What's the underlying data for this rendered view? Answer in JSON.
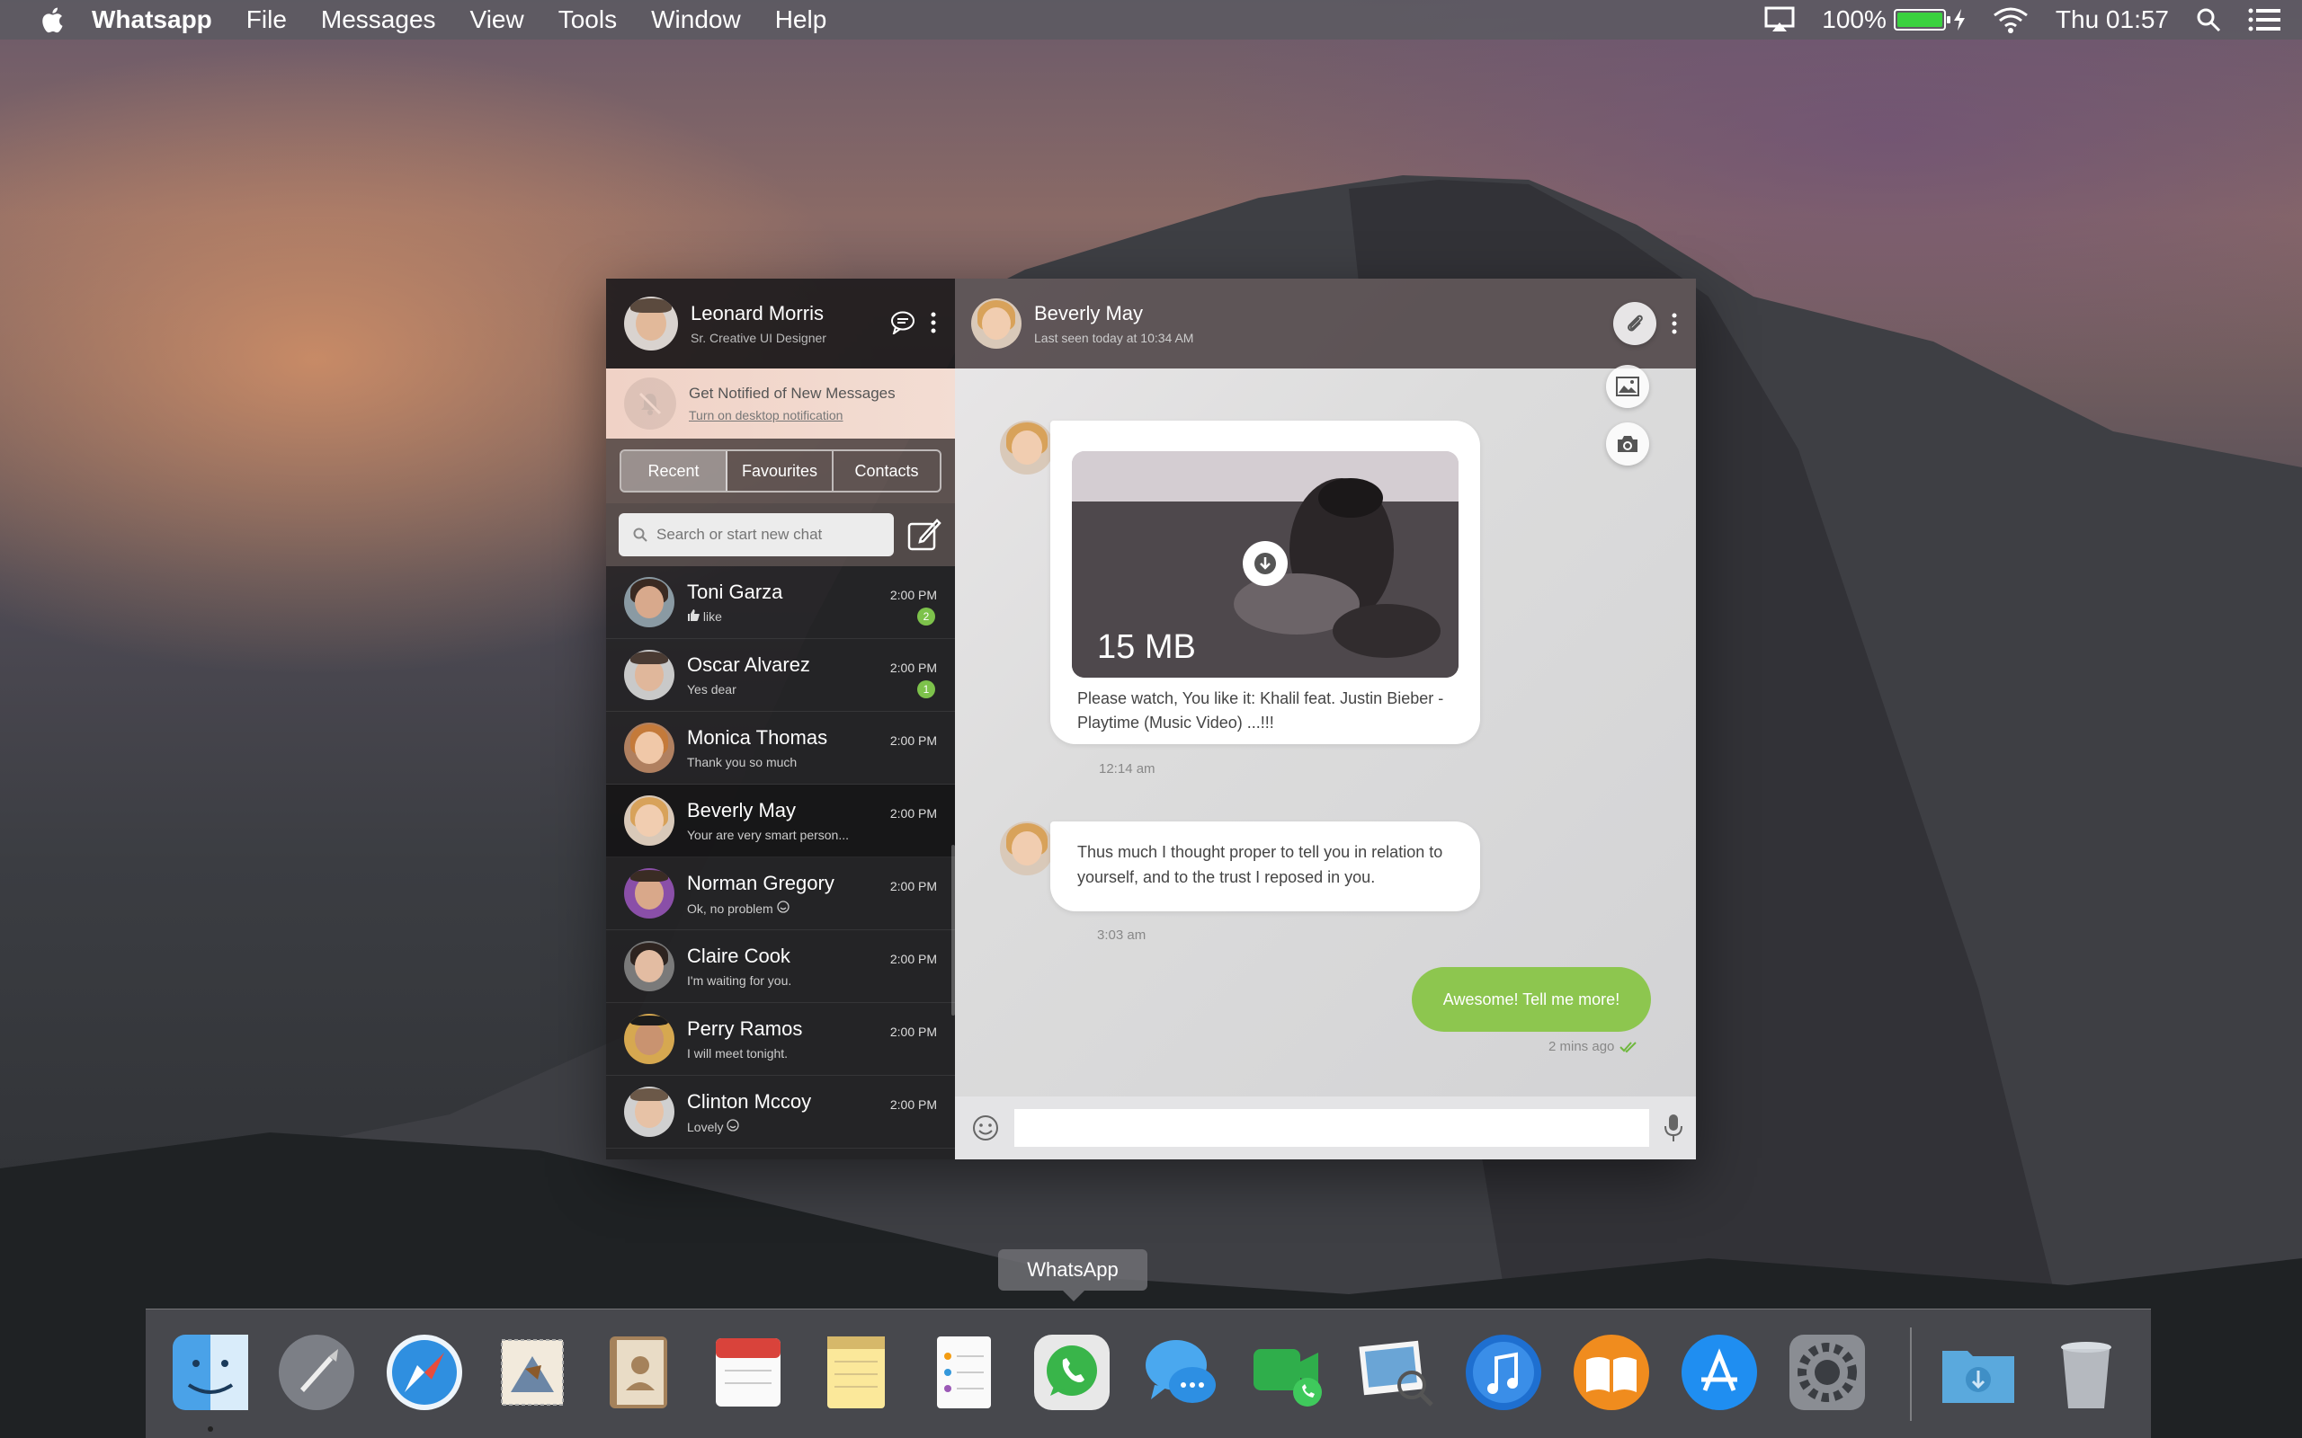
{
  "menubar": {
    "app_name": "Whatsapp",
    "menus": [
      "File",
      "Messages",
      "View",
      "Tools",
      "Window",
      "Help"
    ],
    "battery_percent": "100%",
    "clock": "Thu 01:57"
  },
  "sidebar": {
    "profile": {
      "name": "Leonard Morris",
      "title": "Sr. Creative UI Designer"
    },
    "notification": {
      "title": "Get Notified of New Messages",
      "link": "Turn on desktop notification"
    },
    "tabs": [
      "Recent",
      "Favourites",
      "Contacts"
    ],
    "active_tab": "Recent",
    "search_placeholder": "Search or start new chat",
    "chats": [
      {
        "name": "Toni Garza",
        "preview": "like",
        "time": "2:00 PM",
        "badge": "2"
      },
      {
        "name": "Oscar Alvarez",
        "preview": "Yes dear",
        "time": "2:00 PM",
        "badge": "1"
      },
      {
        "name": "Monica Thomas",
        "preview": "Thank you so much",
        "time": "2:00 PM"
      },
      {
        "name": "Beverly May",
        "preview": "Your are very smart person...",
        "time": "2:00 PM"
      },
      {
        "name": "Norman Gregory",
        "preview": "Ok, no problem",
        "time": "2:00 PM"
      },
      {
        "name": "Claire Cook",
        "preview": "I'm waiting for you.",
        "time": "2:00 PM"
      },
      {
        "name": "Perry Ramos",
        "preview": "I will meet tonight.",
        "time": "2:00 PM"
      },
      {
        "name": "Clinton Mccoy",
        "preview": "Lovely",
        "time": "2:00 PM"
      }
    ]
  },
  "chat": {
    "contact_name": "Beverly May",
    "last_seen": "Last seen today at 10:34 AM",
    "messages": [
      {
        "type": "video",
        "size": "15 MB",
        "caption_line1": "Please watch, You like it: Khalil feat. Justin Bieber -",
        "caption_line2": "Playtime (Music Video) ...!!!",
        "time": "12:14 am"
      },
      {
        "type": "text",
        "line1": "Thus much I thought proper to tell you in relation to",
        "line2": "yourself, and to the trust I reposed in you.",
        "time": "3:03 am"
      },
      {
        "type": "sent",
        "text": "Awesome! Tell me more!",
        "time": "2 mins ago"
      }
    ],
    "input_value": ""
  },
  "dock": {
    "tooltip": "WhatsApp"
  },
  "colors": {
    "accent_green": "#8dc64f",
    "badge_green": "#7dc24b",
    "battery_green": "#3ad13f"
  }
}
